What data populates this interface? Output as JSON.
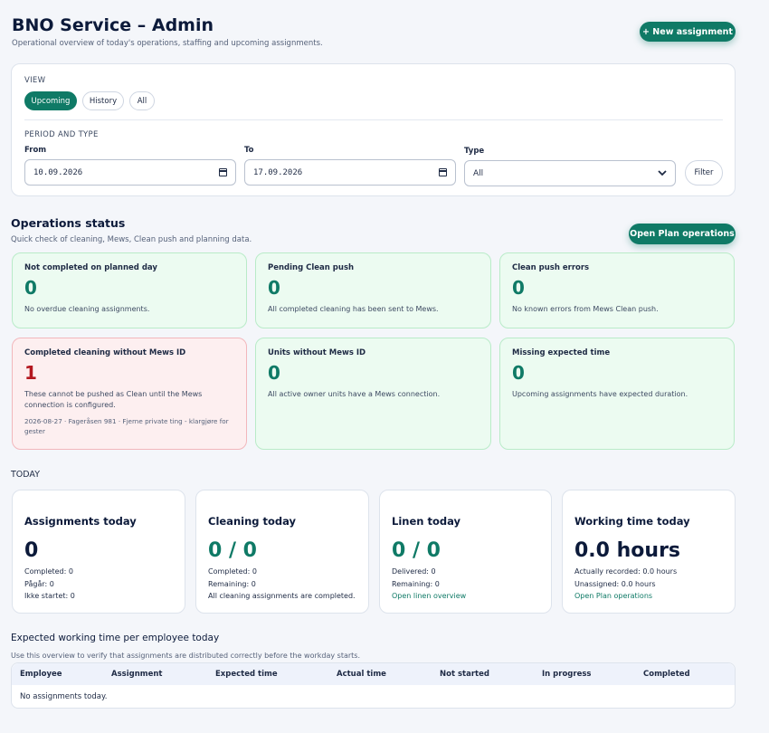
{
  "header": {
    "title": "BNO Service – Admin",
    "subtitle": "Operational overview of today's operations, staffing and upcoming assignments.",
    "new_assignment": "+ New assignment"
  },
  "filters": {
    "view_label": "VIEW",
    "view_options": [
      "Upcoming",
      "History",
      "All"
    ],
    "view_selected": "Upcoming",
    "period_label": "PERIOD AND TYPE",
    "from_label": "From",
    "from_value": "10.09.2026",
    "to_label": "To",
    "to_value": "17.09.2026",
    "type_label": "Type",
    "type_value": "All",
    "filter_button": "Filter"
  },
  "operations": {
    "title": "Operations status",
    "subtitle": "Quick check of cleaning, Mews, Clean push and planning data.",
    "open_plan": "Open Plan operations",
    "cards": [
      {
        "title": "Not completed on planned day",
        "value": "0",
        "desc": "No overdue cleaning assignments.",
        "state": "ok"
      },
      {
        "title": "Pending Clean push",
        "value": "0",
        "desc": "All completed cleaning has been sent to Mews.",
        "state": "ok"
      },
      {
        "title": "Clean push errors",
        "value": "0",
        "desc": "No known errors from Mews Clean push.",
        "state": "ok"
      },
      {
        "title": "Completed cleaning without Mews ID",
        "value": "1",
        "desc": "These cannot be pushed as Clean until the Mews connection is configured.",
        "extra": "2026-08-27 · Fageråsen 981 · Fjerne private ting - klargjøre for gester",
        "state": "bad"
      },
      {
        "title": "Units without Mews ID",
        "value": "0",
        "desc": "All active owner units have a Mews connection.",
        "state": "ok"
      },
      {
        "title": "Missing expected time",
        "value": "0",
        "desc": "Upcoming assignments have expected duration.",
        "state": "ok"
      }
    ]
  },
  "today": {
    "label": "TODAY",
    "cards": [
      {
        "title": "Assignments today",
        "value": "0",
        "lines": [
          "Completed: 0",
          "Pågår: 0",
          "Ikke startet: 0"
        ]
      },
      {
        "title": "Cleaning today",
        "value": "0 / 0",
        "lines": [
          "Completed: 0",
          "Remaining: 0",
          "All cleaning assignments are completed."
        ]
      },
      {
        "title": "Linen today",
        "value": "0 / 0",
        "lines": [
          "Delivered: 0",
          "Remaining: 0"
        ],
        "link": "Open linen overview"
      },
      {
        "title": "Working time today",
        "value": "0.0 hours",
        "lines": [
          "Actually recorded: 0.0 hours",
          "Unassigned: 0.0 hours"
        ],
        "link": "Open Plan operations"
      }
    ]
  },
  "employees": {
    "title": "Expected working time per employee today",
    "subtitle": "Use this overview to verify that assignments are distributed correctly before the workday starts.",
    "columns": [
      "Employee",
      "Assignment",
      "Expected time",
      "Actual time",
      "Not started",
      "In progress",
      "Completed"
    ],
    "empty": "No assignments today."
  },
  "colors": {
    "accent": "#0f7a66",
    "ok_bg": "#ecfbf1",
    "error_bg": "#fdeff0",
    "error_text": "#b3171f"
  }
}
